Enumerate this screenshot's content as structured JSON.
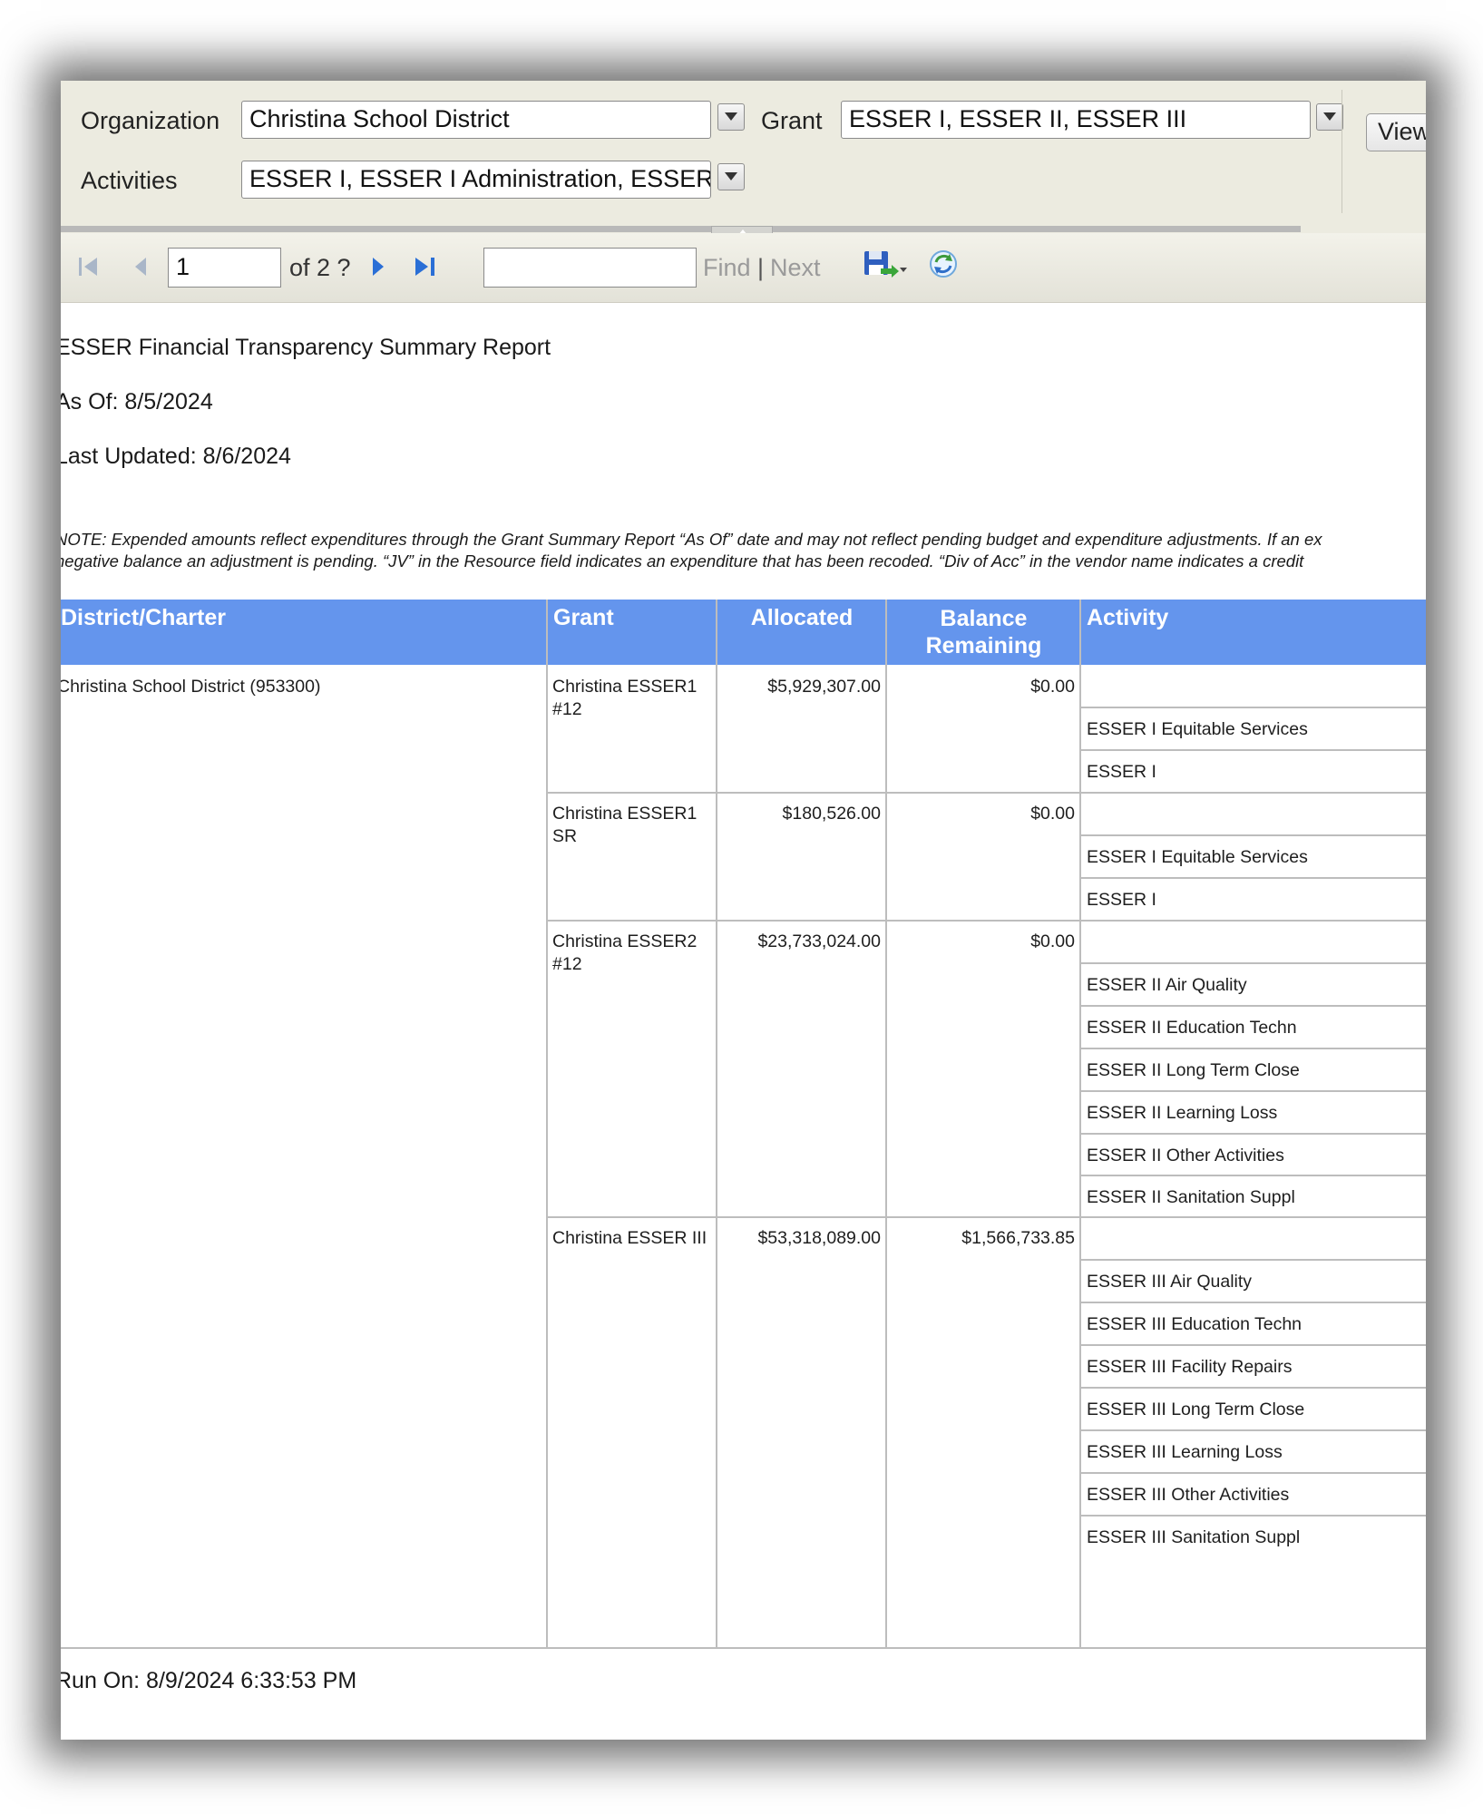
{
  "params": {
    "organization_label": "Organization",
    "organization_value": "Christina School District",
    "grant_label": "Grant",
    "grant_value": "ESSER I, ESSER II, ESSER III",
    "activities_label": "Activities",
    "activities_value": "ESSER I, ESSER I Administration, ESSER I",
    "view_button": "View"
  },
  "toolbar": {
    "page_value": "1",
    "of_text": "of 2 ?",
    "find_label": "Find",
    "separator": "|",
    "next_label": "Next"
  },
  "report": {
    "title": "ESSER Financial Transparency Summary Report",
    "as_of": "As Of: 8/5/2024",
    "last_updated": "Last Updated: 8/6/2024",
    "note_line1": "NOTE: Expended amounts reflect expenditures through the Grant Summary Report “As Of” date and may not reflect pending budget and expenditure adjustments.  If an ex",
    "note_line2": "negative balance an adjustment is pending.  “JV” in the Resource field indicates an expenditure that has been recoded.  “Div of Acc” in the vendor name indicates a credit",
    "run_on": "Run On: 8/9/2024 6:33:53 PM"
  },
  "table": {
    "headers": {
      "district": "District/Charter",
      "grant": "Grant",
      "allocated": "Allocated",
      "balance_line1": "Balance",
      "balance_line2": "Remaining",
      "activity": "Activity"
    },
    "district_name": "Christina School District (953300)",
    "grants": [
      {
        "name_line1": "Christina ESSER1",
        "name_line2": "#12",
        "allocated": "$5,929,307.00",
        "balance": "$0.00",
        "activities": [
          "",
          "ESSER I Equitable Services",
          "ESSER I"
        ]
      },
      {
        "name_line1": "Christina ESSER1",
        "name_line2": "SR",
        "allocated": "$180,526.00",
        "balance": "$0.00",
        "activities": [
          "",
          "ESSER I Equitable Services",
          "ESSER I"
        ]
      },
      {
        "name_line1": "Christina ESSER2",
        "name_line2": "#12",
        "allocated": "$23,733,024.00",
        "balance": "$0.00",
        "activities": [
          "",
          "ESSER II Air Quality",
          "ESSER II Education Techn",
          "ESSER II Long Term Close",
          "ESSER II Learning Loss",
          "ESSER II Other Activities",
          "ESSER II Sanitation Suppl"
        ]
      },
      {
        "name_line1": "Christina ESSER III",
        "name_line2": "",
        "allocated": "$53,318,089.00",
        "balance": "$1,566,733.85",
        "activities": [
          "",
          "ESSER III Air Quality",
          "ESSER III Education Techn",
          "ESSER III Facility Repairs",
          "ESSER III Long Term Close",
          "ESSER III Learning Loss",
          "ESSER III Other Activities",
          "ESSER III Sanitation Suppl"
        ]
      }
    ]
  },
  "colors": {
    "header_bg": "#6495ed",
    "param_bg": "#ecebe0",
    "nav_icon": "#2a6fd6"
  },
  "icons": [
    "first-page-icon",
    "previous-page-icon",
    "next-page-icon",
    "last-page-icon",
    "export-save-icon",
    "refresh-icon"
  ]
}
